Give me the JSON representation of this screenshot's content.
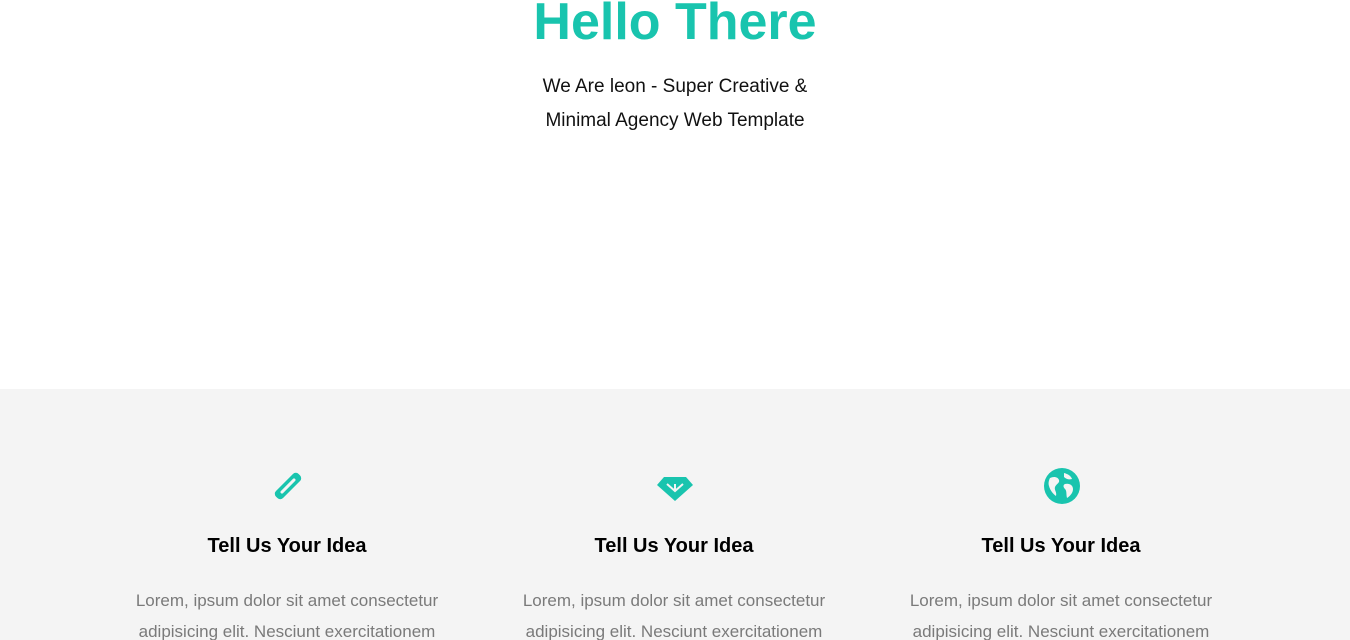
{
  "hero": {
    "title": "Hello There",
    "subtitle_line1": "We Are leon - Super Creative &",
    "subtitle_line2": "Minimal Agency Web Template"
  },
  "colors": {
    "accent": "#19c4ae",
    "features_bg": "#f4f4f4",
    "body_text": "#7a7a7a"
  },
  "features": [
    {
      "icon": "pencil-icon",
      "title": "Tell Us Your Idea",
      "text_line1": "Lorem, ipsum dolor sit amet consectetur",
      "text_line2": "adipisicing elit. Nesciunt exercitationem"
    },
    {
      "icon": "diamond-icon",
      "title": "Tell Us Your Idea",
      "text_line1": "Lorem, ipsum dolor sit amet consectetur",
      "text_line2": "adipisicing elit. Nesciunt exercitationem"
    },
    {
      "icon": "globe-icon",
      "title": "Tell Us Your Idea",
      "text_line1": "Lorem, ipsum dolor sit amet consectetur",
      "text_line2": "adipisicing elit. Nesciunt exercitationem"
    }
  ]
}
